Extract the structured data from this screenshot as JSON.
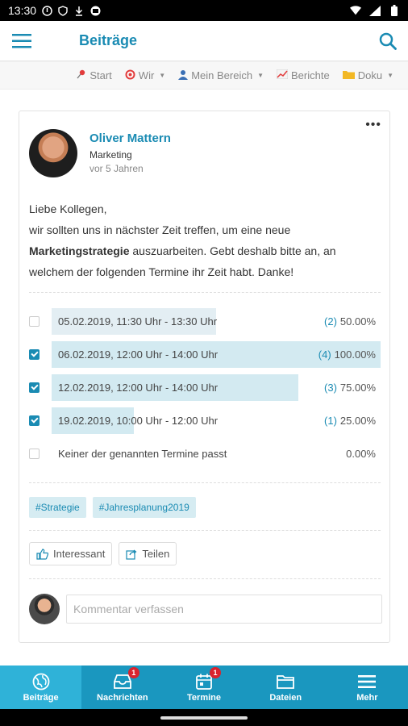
{
  "status": {
    "time": "13:30"
  },
  "appbar": {
    "title": "Beiträge"
  },
  "subnav": {
    "items": [
      {
        "label": "Start",
        "icon": "pin-icon"
      },
      {
        "label": "Wir",
        "icon": "target-icon",
        "dropdown": true
      },
      {
        "label": "Mein Bereich",
        "icon": "person-icon",
        "dropdown": true
      },
      {
        "label": "Berichte",
        "icon": "chart-icon"
      },
      {
        "label": "Doku",
        "icon": "folder-icon",
        "dropdown": true
      }
    ]
  },
  "post": {
    "author": "Oliver Mattern",
    "department": "Marketing",
    "time": "vor 5 Jahren",
    "text_line1": "Liebe Kollegen,",
    "text_line2": "wir sollten uns in nächster Zeit treffen, um eine neue",
    "text_bold": "Marketingstrategie",
    "text_line3_rest": " auszuarbeiten. Gebt deshalb bitte an, an",
    "text_line4": "welchem der folgenden Termine ihr Zeit habt. Danke!",
    "poll": [
      {
        "label": "05.02.2019, 11:30 Uhr - 13:30 Uhr",
        "count": "(2)",
        "percent": "50.00%",
        "fraction": 0.5,
        "checked": false
      },
      {
        "label": "06.02.2019, 12:00 Uhr - 14:00 Uhr",
        "count": "(4)",
        "percent": "100.00%",
        "fraction": 1.0,
        "checked": true
      },
      {
        "label": "12.02.2019, 12:00 Uhr - 14:00 Uhr",
        "count": "(3)",
        "percent": "75.00%",
        "fraction": 0.75,
        "checked": true
      },
      {
        "label": "19.02.2019, 10:00 Uhr - 12:00 Uhr",
        "count": "(1)",
        "percent": "25.00%",
        "fraction": 0.25,
        "checked": true
      },
      {
        "label": "Keiner der genannten Termine passt",
        "count": "",
        "percent": "0.00%",
        "fraction": 0,
        "checked": false
      }
    ],
    "tags": [
      "#Strategie",
      "#Jahresplanung2019"
    ],
    "like_label": "Interessant",
    "share_label": "Teilen",
    "comment_placeholder": "Kommentar verfassen"
  },
  "bottomnav": {
    "items": [
      {
        "label": "Beiträge",
        "icon": "globe-icon",
        "badge": ""
      },
      {
        "label": "Nachrichten",
        "icon": "inbox-icon",
        "badge": "1"
      },
      {
        "label": "Termine",
        "icon": "calendar-icon",
        "badge": "1"
      },
      {
        "label": "Dateien",
        "icon": "folder-icon",
        "badge": ""
      },
      {
        "label": "Mehr",
        "icon": "menu-icon",
        "badge": ""
      }
    ]
  },
  "colors": {
    "accent": "#1a8bb3",
    "nav_bg": "#1a97bf",
    "nav_active": "#2fb2d8",
    "badge": "#d9232e"
  }
}
